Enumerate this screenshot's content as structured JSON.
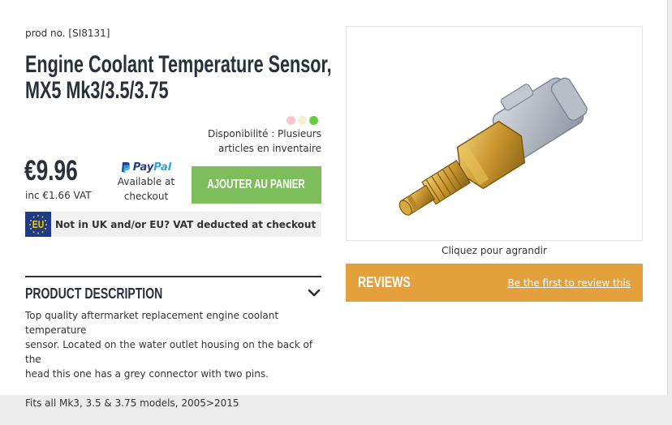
{
  "product": {
    "prod_no": "prod no. [SI8131]",
    "title_line1": "Engine Coolant Temperature Sensor,",
    "title_line2": "MX5 Mk3/3.5/3.75",
    "availability_line1": "Disponibilité : Plusieurs",
    "availability_line2": "articles en inventaire",
    "stock_colors": [
      "#f7c9cf",
      "#f5efd0",
      "#5fd03a"
    ],
    "price": "€9.96",
    "vat_label": "inc  €1.66 VAT"
  },
  "paypal": {
    "logo_part1": "Pay",
    "logo_part2": "Pal",
    "line1": "Available at",
    "line2": "checkout"
  },
  "cart": {
    "button_label": "AJOUTER AU PANIER",
    "color": "#7dbd5b"
  },
  "eu_banner": {
    "flag_text": "EU",
    "message": "Not in UK and/or EU? VAT deducted at checkout"
  },
  "description": {
    "heading": "PRODUCT DESCRIPTION",
    "line1": "Top quality aftermarket replacement engine coolant temperature",
    "line2": "sensor. Located on the water outlet housing on the back of the",
    "line3": "head this one has a grey connector with two pins.",
    "fitment": "Fits all Mk3, 3.5 & 3.75 models, 2005>2015"
  },
  "image": {
    "caption": "Cliquez pour agrandir"
  },
  "reviews": {
    "title": "REVIEWS",
    "link": "Be the first to review this",
    "color": "#e5a03e"
  }
}
